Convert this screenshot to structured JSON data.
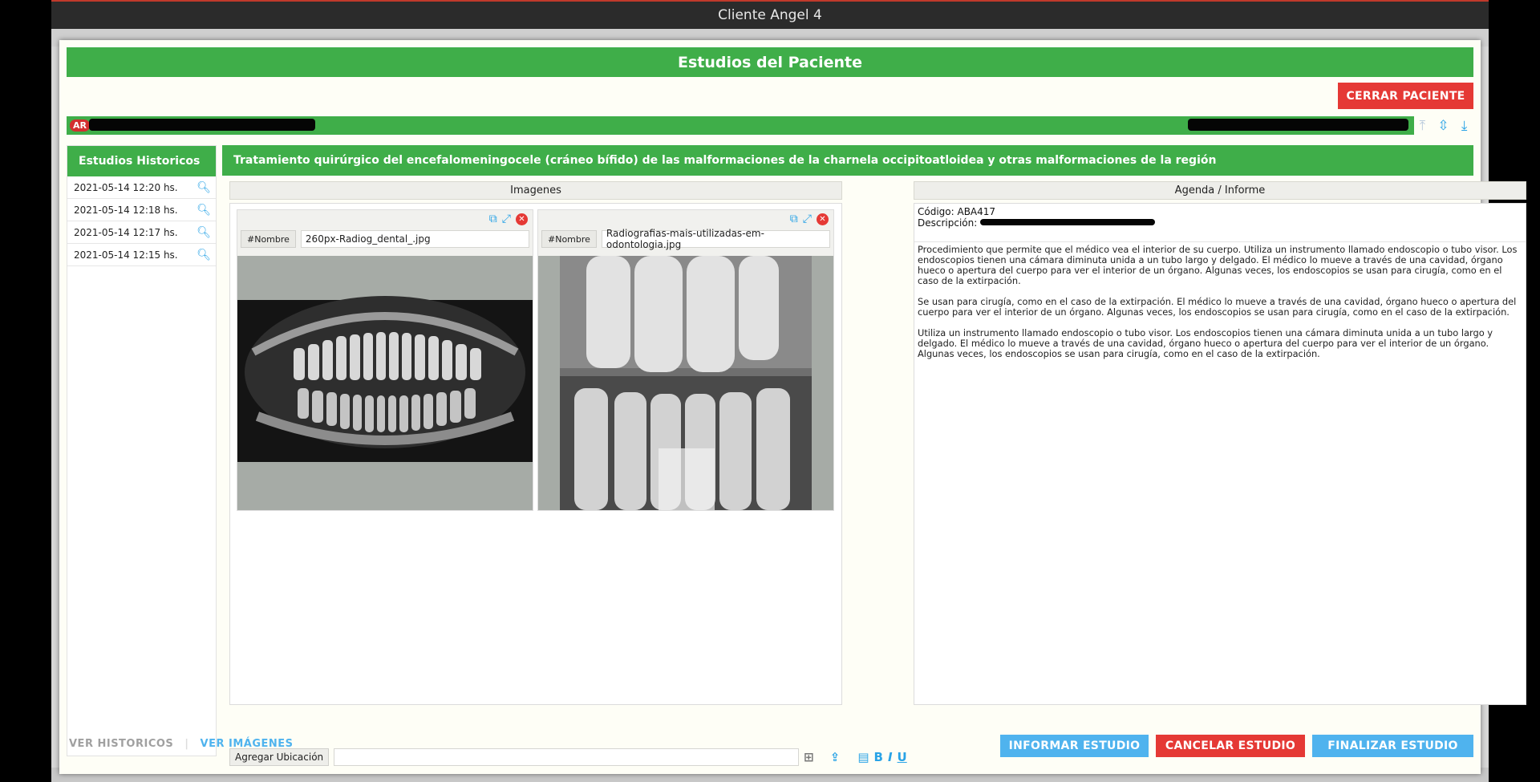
{
  "window": {
    "title": "Cliente Angel 4"
  },
  "modal": {
    "title": "Estudios del Paciente",
    "close_patient_label": "CERRAR PACIENTE"
  },
  "patient_bar": {
    "flag": "AR"
  },
  "history": {
    "title": "Estudios Historicos",
    "items": [
      "2021-05-14 12:20 hs.",
      "2021-05-14 12:18 hs.",
      "2021-05-14 12:17 hs.",
      "2021-05-14 12:15 hs."
    ]
  },
  "study": {
    "title": "Tratamiento quirúrgico del encefalomeningocele (cráneo bífido) de las malformaciones de la charnela occipitoatloidea y otras malformaciones de la región",
    "images_header": "Imagenes",
    "agenda_header": "Agenda / Informe",
    "images": [
      {
        "tag": "#Nombre",
        "name": "260px-Radiog_dental_.jpg"
      },
      {
        "tag": "#Nombre",
        "name": "Radiografias-mais-utilizadas-em-odontologia.jpg"
      }
    ],
    "codigo_label": "Código: ABA417",
    "descripcion_label": "Descripción:",
    "report_paragraphs": [
      "Procedimiento que permite que el médico vea el interior de su cuerpo. Utiliza un instrumento llamado endoscopio o tubo visor. Los endoscopios tienen una cámara diminuta unida a un tubo largo y delgado. El médico lo mueve a través de una cavidad, órgano hueco o apertura del cuerpo para ver el interior de un órgano. Algunas veces, los endoscopios se usan para cirugía, como en el caso de la extirpación.",
      "Se usan para cirugía, como en el caso de la extirpación. El médico lo mueve a través de una cavidad, órgano hueco o apertura del cuerpo para ver el interior de un órgano. Algunas veces, los endoscopios se usan para cirugía, como en el caso de la extirpación.",
      "Utiliza un instrumento llamado endoscopio o tubo visor. Los endoscopios tienen una cámara diminuta unida a un tubo largo y delgado. El médico lo mueve a través de una cavidad, órgano hueco o apertura del cuerpo para ver el interior de un órgano. Algunas veces, los endoscopios se usan para cirugía, como en el caso de la extirpación."
    ],
    "add_location_label": "Agregar Ubicación"
  },
  "footer": {
    "ver_historicos": "VER HISTORICOS",
    "ver_imagenes": "VER IMÁGENES",
    "informar": "INFORMAR ESTUDIO",
    "cancelar": "CANCELAR ESTUDIO",
    "finalizar": "FINALIZAR ESTUDIO"
  },
  "colors": {
    "green": "#3fae49",
    "red": "#e53935",
    "blue": "#4fb3ee",
    "icon_blue": "#29a3e6"
  },
  "icons": [
    "crop-icon",
    "expand-icon",
    "close-icon",
    "search-icon",
    "add-icon",
    "upload-icon",
    "document-icon",
    "bold-icon",
    "italic-icon",
    "underline-icon",
    "scroll-top-icon",
    "collapse-icon",
    "download-icon"
  ]
}
